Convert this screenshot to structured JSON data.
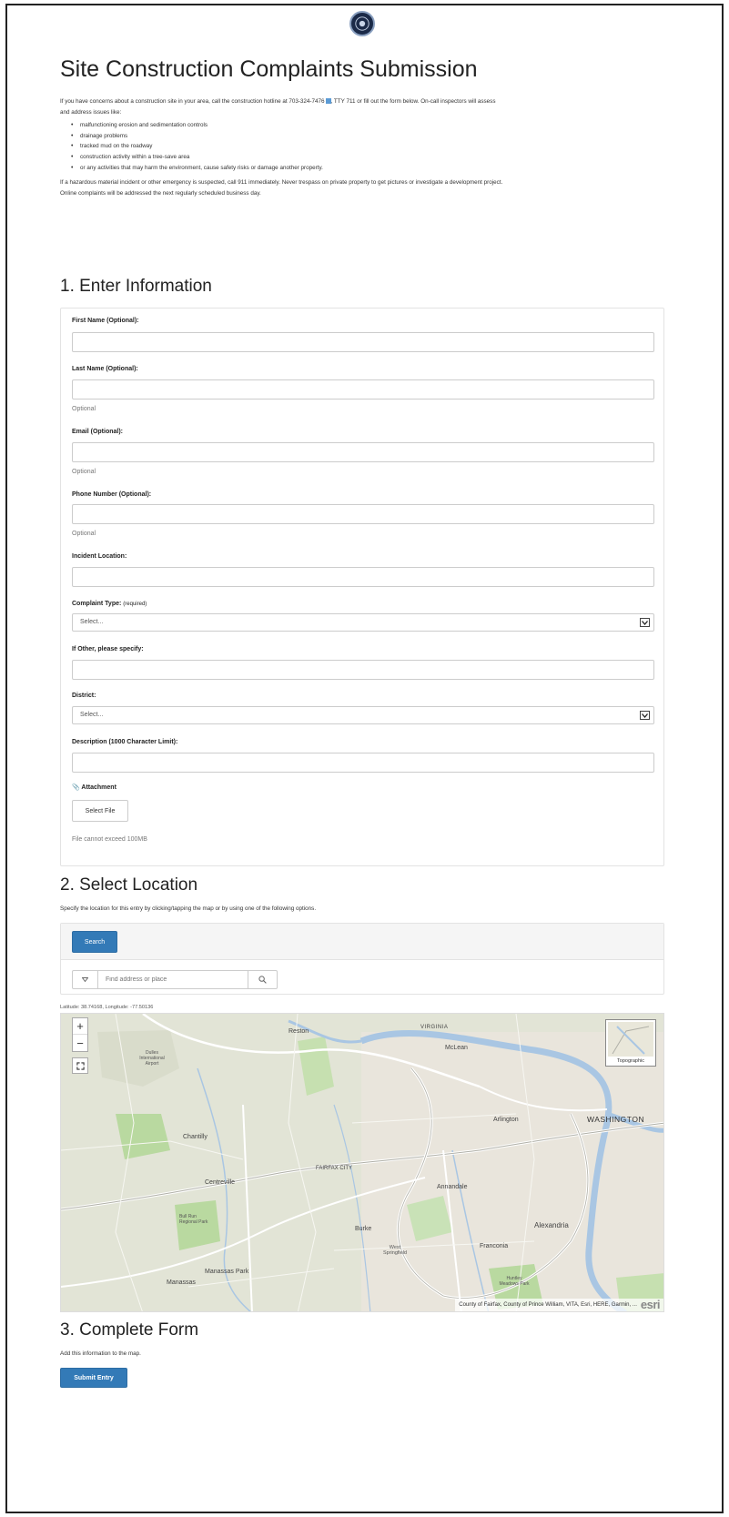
{
  "header": {
    "title": "Site Construction Complaints Submission"
  },
  "intro": {
    "line1_before": "If you have concerns about a construction site in your area, call the construction hotline at 703-324-7476",
    "line1_after": ", TTY 711 or fill out the form below. On-call inspectors will assess",
    "line2": "and address issues like:",
    "bullets": [
      "malfunctioning erosion and sedimentation controls",
      "drainage problems",
      "tracked mud on the roadway",
      "construction activity within a tree-save area",
      "or any activities that may harm the environment, cause safety risks or damage another property."
    ],
    "warning1": "If a hazardous material incident or other emergency is suspected, call 911 immediately. Never trespass on private property to get pictures or investigate a development project.",
    "warning2": "Online complaints will be addressed the next regularly scheduled business day."
  },
  "section1": {
    "title": "1. Enter Information",
    "first_name_label": "First Name (Optional):",
    "last_name_label": "Last Name (Optional):",
    "last_name_help": "Optional",
    "email_label": "Email (Optional):",
    "email_help": "Optional",
    "phone_label": "Phone Number (Optional):",
    "phone_help": "Optional",
    "location_label": "Incident Location:",
    "complaint_label": "Complaint Type:",
    "complaint_required": "(required)",
    "complaint_value": "Select...",
    "other_label": "If Other, please specify:",
    "district_label": "District:",
    "district_value": "Select...",
    "description_label": "Description (1000 Character Limit):",
    "attachment_label": "Attachment",
    "select_file": "Select File",
    "file_note": "File cannot exceed 100MB"
  },
  "section2": {
    "title": "2. Select Location",
    "description": "Specify the location for this entry by clicking/tapping the map or by using one of the following options.",
    "search_button": "Search",
    "search_placeholder": "Find address or place",
    "coords": "Latitude: 38.74168,  Longitude: -77.50136"
  },
  "map": {
    "basemap": "Topographic",
    "attribution": "County of Fairfax, County of Prince William, VITA, Esri, HERE, Garmin, ...",
    "esri_logo": "esri",
    "places": {
      "reston": "Reston",
      "virginia": "VIRGINIA",
      "mclean": "McLean",
      "dulles": "Dulles International Airport",
      "arlington": "Arlington",
      "washington": "WASHINGTON",
      "chantilly": "Chantilly",
      "fairfax": "FAIRFAX CITY",
      "centreville": "Centreville",
      "annandale": "Annandale",
      "alexandria": "Alexandria",
      "burke": "Burke",
      "franconia": "Franconia",
      "west_springfield": "West Springfield",
      "manassas_park": "Manassas Park",
      "manassas": "Manassas",
      "bull_run": "Bull Run Regional Park",
      "huntley": "Huntley Meadows Park"
    }
  },
  "section3": {
    "title": "3. Complete Form",
    "description": "Add this information to the map.",
    "submit": "Submit Entry"
  },
  "colors": {
    "primary": "#337ab7",
    "water": "#a9c6e3",
    "park": "#b9d9a0",
    "road": "#ffffff"
  }
}
